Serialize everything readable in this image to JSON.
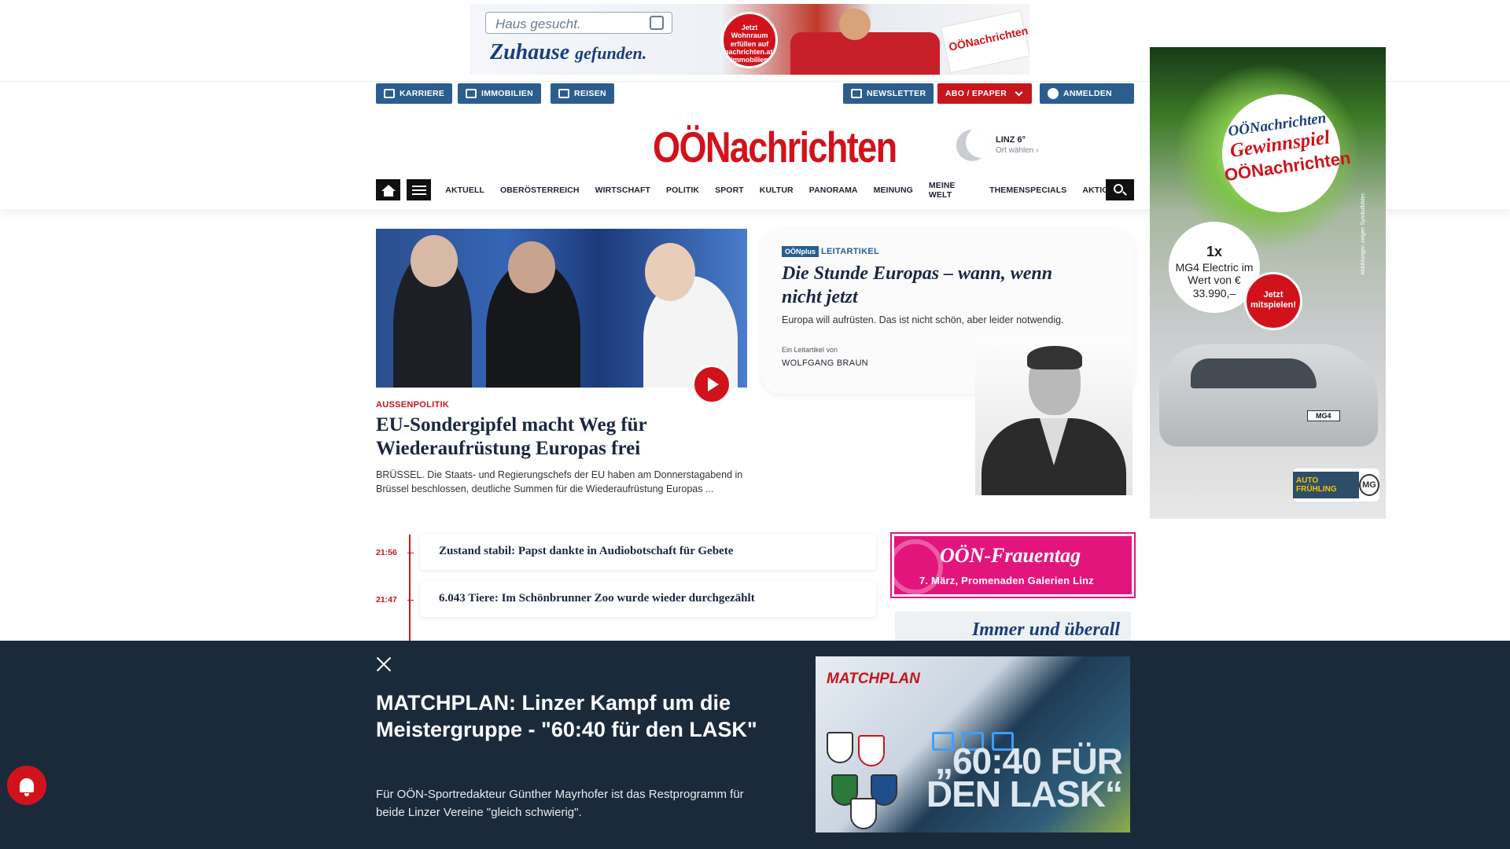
{
  "top_ad": {
    "search_text": "Haus gesucht.",
    "slogan_main": "Zuhause",
    "slogan_tail": "gefunden.",
    "badge": "Jetzt Wohnraum erfüllen auf nachrichten.at/ immobilien",
    "paper": "OÖNachrichten"
  },
  "header": {
    "top_links": [
      {
        "label": "KARRIERE",
        "icon": "briefcase-icon"
      },
      {
        "label": "IMMOBILIEN",
        "icon": "building-icon"
      },
      {
        "label": "REISEN",
        "icon": "plane-icon"
      }
    ],
    "newsletter": "NEWSLETTER",
    "abo": "ABO / EPAPER",
    "login": "ANMELDEN",
    "logo": "OÖNachrichten",
    "weather": {
      "city": "LINZ 6°",
      "change": "Ort wählen"
    }
  },
  "nav": {
    "items": [
      "AKTUELL",
      "OBERÖSTERREICH",
      "WIRTSCHAFT",
      "POLITIK",
      "SPORT",
      "KULTUR",
      "PANORAMA",
      "MEINUNG",
      "MEINE WELT",
      "THEMENSPECIALS",
      "AKTIONEN"
    ]
  },
  "lead": {
    "kicker": "AUSSENPOLITIK",
    "title": "EU-Sondergipfel macht Weg für Wiederaufrüstung Europas frei",
    "teaser": "BRÜSSEL. Die Staats- und Regierungschefs der EU haben am Donnerstagabend in Brüssel beschlossen, deutliche Summen für die Wiederaufrüstung Europas ..."
  },
  "leitartikel": {
    "badge": "OÖNplus",
    "kicker": "LEITARTIKEL",
    "title": "Die Stunde Europas – wann, wenn nicht jetzt",
    "teaser": "Europa will aufrüsten. Das ist nicht schön, aber leider notwendig.",
    "byline_label": "Ein Leitartikel von",
    "author": "WOLFGANG BRAUN"
  },
  "ticker": [
    {
      "time": "21:56",
      "title": "Zustand stabil: Papst dankte in Audiobotschaft für Gebete"
    },
    {
      "time": "21:47",
      "title": "6.043 Tiere: Im Schönbrunner Zoo wurde wieder durchgezählt"
    }
  ],
  "sky_ad": {
    "brand1": "OÖNachrichten",
    "brand2": "Gewinnspiel",
    "brand3": "OÖNachrichten",
    "win_count": "1x",
    "win_text": "MG4 Electric im Wert von € 33.990,–",
    "cta": "Jetzt mitspielen!",
    "plate": "MG4",
    "side_note": "Abbildungen zeigen Symbolbilder.",
    "auto_label": "AUTO FRÜHLING",
    "mg_label": "MG"
  },
  "frauentag": {
    "title": "OÖN-Frauentag",
    "subtitle": "7. März, Promenaden Galerien Linz"
  },
  "ueberall": "Immer und überall",
  "overlay": {
    "title": "MATCHPLAN: Linzer Kampf um die Meistergruppe - \"60:40 für den LASK\"",
    "teaser": "Für OÖN-Sportredakteur Günther Mayrhofer ist das Restprogramm für beide Linzer Vereine \"gleich schwierig\".",
    "image_title": "MATCHPLAN",
    "image_quote": "„60:40 FÜR DEN LASK“"
  }
}
